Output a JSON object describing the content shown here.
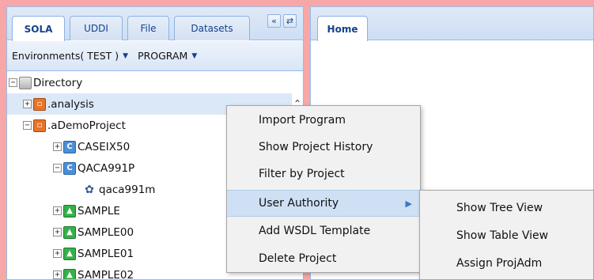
{
  "left_panel": {
    "tabs": [
      {
        "label": "SOLA",
        "active": true
      },
      {
        "label": "UDDI",
        "active": false
      },
      {
        "label": "File",
        "active": false
      },
      {
        "label": "Datasets",
        "active": false
      }
    ],
    "tool_icons": [
      "collapse-left-icon",
      "refresh-icon"
    ],
    "env_menu": {
      "label": "Environments( TEST )"
    },
    "program_menu": {
      "label": "PROGRAM"
    },
    "tree": [
      {
        "label": "Directory",
        "icon": "directory-icon",
        "expander": "−"
      },
      {
        "label": ".analysis",
        "icon": "project-icon",
        "expander": "+",
        "selected": true
      },
      {
        "label": ".aDemoProject",
        "icon": "project-icon",
        "expander": "−"
      },
      {
        "label": "CASEIX50",
        "icon": "program-c-icon",
        "expander": "+"
      },
      {
        "label": "QACA991P",
        "icon": "program-c-icon",
        "expander": "−"
      },
      {
        "label": "qaca991m",
        "icon": "gear-icon",
        "expander": ""
      },
      {
        "label": "SAMPLE",
        "icon": "upload-icon",
        "expander": "+"
      },
      {
        "label": "SAMPLE00",
        "icon": "upload-icon",
        "expander": "+"
      },
      {
        "label": "SAMPLE01",
        "icon": "upload-icon",
        "expander": "+"
      },
      {
        "label": "SAMPLE02",
        "icon": "upload-icon",
        "expander": "+"
      }
    ]
  },
  "right_panel": {
    "tab": {
      "label": "Home"
    }
  },
  "context_menu": {
    "items": [
      {
        "label": "Import Program"
      },
      {
        "label": "Show Project History"
      },
      {
        "label": "Filter by Project"
      },
      {
        "label": "User Authority",
        "has_submenu": true,
        "highlighted": true
      },
      {
        "label": "Add WSDL Template"
      },
      {
        "label": "Delete Project"
      }
    ]
  },
  "submenu": {
    "items": [
      {
        "label": "Show Tree View"
      },
      {
        "label": "Show Table View"
      },
      {
        "label": "Assign ProjAdm"
      }
    ]
  }
}
